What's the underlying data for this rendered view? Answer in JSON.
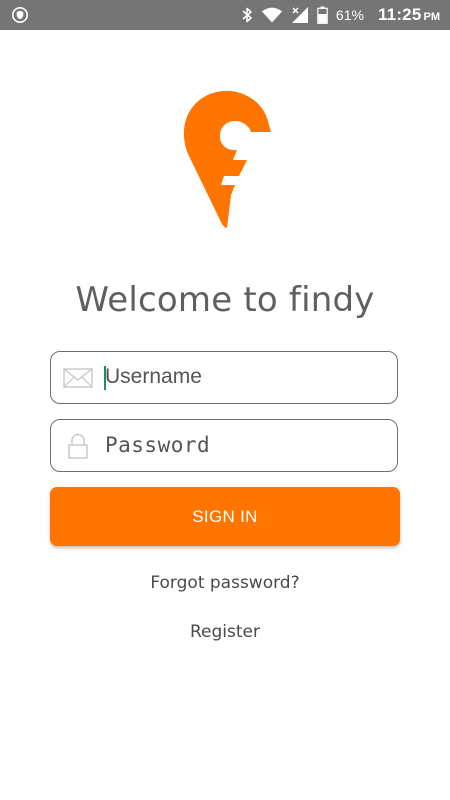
{
  "status_bar": {
    "battery_percent": "61%",
    "time": "11:25",
    "ampm": "PM",
    "icons": [
      "shield-icon",
      "bluetooth-icon",
      "wifi-icon",
      "signal-icon",
      "battery-icon"
    ]
  },
  "logo": {
    "icon": "findy-logo-icon",
    "color": "#ff7500"
  },
  "welcome": {
    "title": "Welcome to findy"
  },
  "form": {
    "username": {
      "icon": "envelope-icon",
      "placeholder": "Username"
    },
    "password": {
      "icon": "lock-icon",
      "placeholder": "Password"
    },
    "signin_label": "SIGN IN"
  },
  "links": {
    "forgot": "Forgot password?",
    "register": "Register"
  },
  "colors": {
    "accent": "#ff7500",
    "status_bar": "#757575",
    "cursor": "#1f8a70"
  }
}
